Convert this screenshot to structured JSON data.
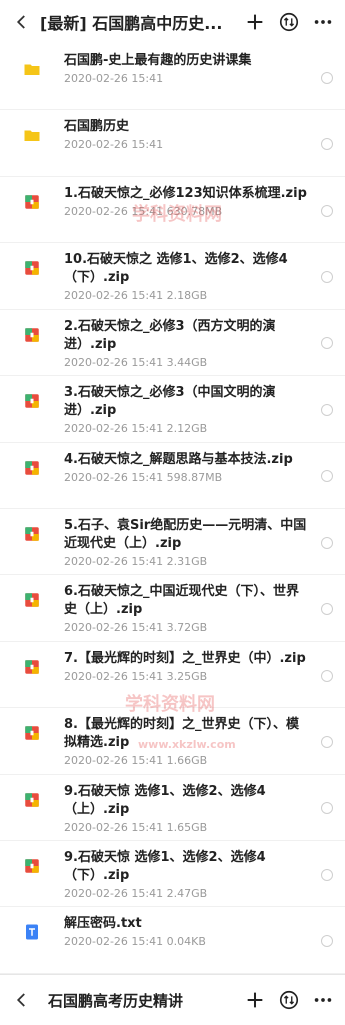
{
  "header": {
    "title": "[最新] 石国鹏高中历史..."
  },
  "icons": {
    "back": "back-icon",
    "add": "plus-icon",
    "sort": "sort-icon",
    "more": "more-icon"
  },
  "files": [
    {
      "name": "石国鹏-史上最有趣的历史讲课集",
      "date": "2020-02-26  15:41",
      "size": "",
      "type": "folder"
    },
    {
      "name": "石国鹏历史",
      "date": "2020-02-26  15:41",
      "size": "",
      "type": "folder"
    },
    {
      "name": "1.石破天惊之_必修123知识体系梳理.zip",
      "date": "2020-02-26  15:41",
      "size": "630.78MB",
      "type": "zip"
    },
    {
      "name": "10.石破天惊之 选修1、选修2、选修4（下）.zip",
      "date": "2020-02-26  15:41",
      "size": "2.18GB",
      "type": "zip"
    },
    {
      "name": "2.石破天惊之_必修3（西方文明的演进）.zip",
      "date": "2020-02-26  15:41",
      "size": "3.44GB",
      "type": "zip"
    },
    {
      "name": "3.石破天惊之_必修3（中国文明的演进）.zip",
      "date": "2020-02-26  15:41",
      "size": "2.12GB",
      "type": "zip"
    },
    {
      "name": "4.石破天惊之_解题思路与基本技法.zip",
      "date": "2020-02-26  15:41",
      "size": "598.87MB",
      "type": "zip"
    },
    {
      "name": "5.石子、袁Sir绝配历史——元明清、中国近现代史（上）.zip",
      "date": "2020-02-26  15:41",
      "size": "2.31GB",
      "type": "zip"
    },
    {
      "name": "6.石破天惊之_中国近现代史（下）、世界史（上）.zip",
      "date": "2020-02-26  15:41",
      "size": "3.72GB",
      "type": "zip"
    },
    {
      "name": "7.【最光辉的时刻】之_世界史（中）.zip",
      "date": "2020-02-26  15:41",
      "size": "3.25GB",
      "type": "zip"
    },
    {
      "name": "8.【最光辉的时刻】之_世界史（下）、模拟精选.zip",
      "date": "2020-02-26  15:41",
      "size": "1.66GB",
      "type": "zip"
    },
    {
      "name": "9.石破天惊  选修1、选修2、选修4（上）.zip",
      "date": "2020-02-26  15:41",
      "size": "1.65GB",
      "type": "zip"
    },
    {
      "name": "9.石破天惊  选修1、选修2、选修4（下）.zip",
      "date": "2020-02-26  15:41",
      "size": "2.47GB",
      "type": "zip"
    },
    {
      "name": "解压密码.txt",
      "date": "2020-02-26  15:41",
      "size": "0.04KB",
      "type": "txt"
    }
  ],
  "bottom": {
    "title": "石国鹏高考历史精讲"
  },
  "watermark": {
    "text1": "学科资料网",
    "text2": "学科资料网",
    "url": "www.xkzlw.com"
  },
  "colors": {
    "folder": "#F5C518",
    "zip_a": "#E84C3D",
    "zip_b": "#3CB371",
    "txt": "#3B82F6"
  }
}
